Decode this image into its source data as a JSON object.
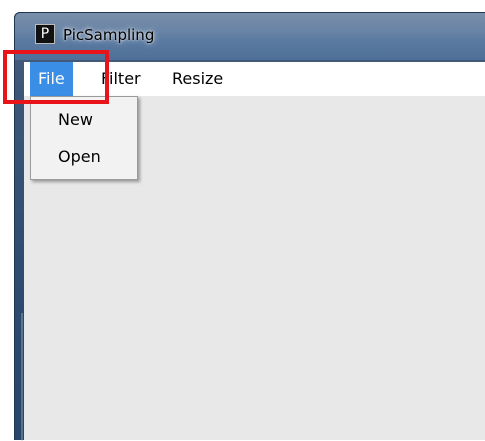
{
  "window": {
    "title": "PicSampling",
    "icon": "processing-p-icon",
    "icon_glyph": "P"
  },
  "menu": {
    "items": [
      {
        "label": "File",
        "selected": true
      },
      {
        "label": "Filter",
        "selected": false
      },
      {
        "label": "Resize",
        "selected": false
      }
    ]
  },
  "dropdown": {
    "parent": "File",
    "items": [
      {
        "label": "New"
      },
      {
        "label": "Open"
      }
    ]
  },
  "colors": {
    "menu_selected_bg": "#3a8ee6",
    "highlight_box": "#e8141a",
    "content_bg": "#e8e8e8"
  }
}
